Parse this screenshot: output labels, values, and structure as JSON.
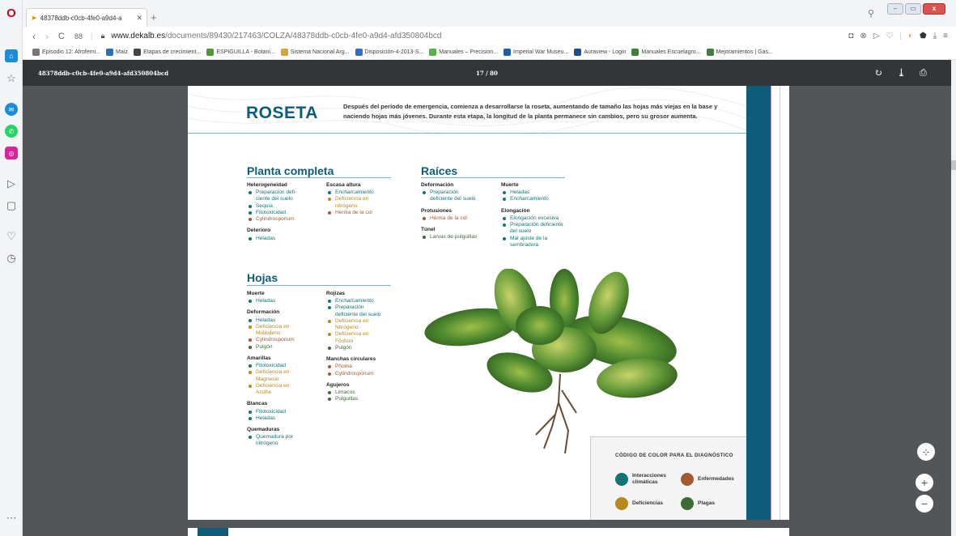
{
  "browser": {
    "tab_title": "48378ddb-c0cb-4fe0-a9d4-a",
    "url_host": "www.dekalb.es",
    "url_path": "/documents/89430/217463/COLZA/48378ddb-c0cb-4fe0-a9d4-afd350804bcd",
    "speed_dial": "88",
    "bookmarks": [
      {
        "label": "Episodio 12: Afrofemi...",
        "color": "#777777"
      },
      {
        "label": "Maíz",
        "color": "#2a6fb8"
      },
      {
        "label": "Etapas de crecimient...",
        "color": "#444444"
      },
      {
        "label": "ESPIGUILLA - Botani...",
        "color": "#4e9a3a"
      },
      {
        "label": "Sistema Nacional Arg...",
        "color": "#d8a534"
      },
      {
        "label": "Disposición-4-2013-S...",
        "color": "#2f6fc2"
      },
      {
        "label": "Manuales – Precision...",
        "color": "#5ab04f"
      },
      {
        "label": "Imperial War Museu...",
        "color": "#1d5fa8"
      },
      {
        "label": "Auraview - Login",
        "color": "#1e4e8f"
      },
      {
        "label": "Manuales Escuelagro...",
        "color": "#3f7f3f"
      },
      {
        "label": "Mejoramientos | Gas...",
        "color": "#3f7f3f"
      }
    ]
  },
  "viewer": {
    "doc_name": "48378ddb-c0cb-4fe0-a9d4-afd350804bcd",
    "page_indicator": "17 / 80"
  },
  "page": {
    "title": "ROSETA",
    "intro": "Después del período de emergencia, comienza a desarrollarse la roseta, aumentando de tamaño las hojas más viejas en la base y naciendo hojas más jóvenes. Durante esta etapa, la longitud de la planta permanece sin cambios, pero su grosor aumenta.",
    "sections": {
      "planta": {
        "title": "Planta completa",
        "col1": [
          {
            "heading": "Heterogeneidad",
            "items": [
              {
                "text": "Preparación defi-",
                "type": "cli"
              },
              {
                "text": "ciente del suelo",
                "type": "cli",
                "cont": true
              },
              {
                "text": "Sequía",
                "type": "cli"
              },
              {
                "text": "Fitotoxicidad",
                "type": "cli"
              },
              {
                "text": "Cylindrosporium",
                "type": "enf"
              }
            ]
          },
          {
            "heading": "Deterioro",
            "items": [
              {
                "text": "Heladas",
                "type": "cli"
              }
            ]
          }
        ],
        "col2": [
          {
            "heading": "Escasa altura",
            "items": [
              {
                "text": "Encharcamiento",
                "type": "cli"
              },
              {
                "text": "Deficiencia en",
                "type": "def"
              },
              {
                "text": "nitrógeno",
                "type": "def",
                "cont": true
              },
              {
                "text": "Hernia de la col",
                "type": "enf"
              }
            ]
          }
        ]
      },
      "raices": {
        "title": "Raíces",
        "col1": [
          {
            "heading": "Deformación",
            "items": [
              {
                "text": "Preparación",
                "type": "cli"
              },
              {
                "text": "deficiente del suelo",
                "type": "cli",
                "cont": true
              }
            ]
          },
          {
            "heading": "Protusiones",
            "items": [
              {
                "text": "Hernia de la col",
                "type": "enf"
              }
            ]
          },
          {
            "heading": "Túnel",
            "items": [
              {
                "text": "Larvas de pulguillas",
                "type": "pla"
              }
            ]
          }
        ],
        "col2": [
          {
            "heading": "Muerte",
            "items": [
              {
                "text": "Heladas",
                "type": "cli"
              },
              {
                "text": "Encharcamiento",
                "type": "cli"
              }
            ]
          },
          {
            "heading": "Elongación",
            "items": [
              {
                "text": "Elongación excesiva",
                "type": "cli"
              },
              {
                "text": "Preparación deficiente",
                "type": "cli"
              },
              {
                "text": "del suelo",
                "type": "cli",
                "cont": true
              },
              {
                "text": "Mal ajuste de la",
                "type": "cli"
              },
              {
                "text": "sembradora",
                "type": "cli",
                "cont": true
              }
            ]
          }
        ]
      },
      "hojas": {
        "title": "Hojas",
        "col1": [
          {
            "heading": "Muerte",
            "items": [
              {
                "text": "Heladas",
                "type": "cli"
              }
            ]
          },
          {
            "heading": "Deformación",
            "items": [
              {
                "text": "Heladas",
                "type": "cli"
              },
              {
                "text": "Deficiencia en",
                "type": "def"
              },
              {
                "text": "Molibdeno",
                "type": "def",
                "cont": true
              },
              {
                "text": "Cylindrosporium",
                "type": "enf"
              },
              {
                "text": "Pulgón",
                "type": "pla"
              }
            ]
          },
          {
            "heading": "Amarillas",
            "items": [
              {
                "text": "Fitotoxicidad",
                "type": "cli"
              },
              {
                "text": "Deficiencia en",
                "type": "def"
              },
              {
                "text": "Magnesio",
                "type": "def",
                "cont": true
              },
              {
                "text": "Deficiencia en",
                "type": "def"
              },
              {
                "text": "Azufre",
                "type": "def",
                "cont": true
              }
            ]
          },
          {
            "heading": "Blancas",
            "items": [
              {
                "text": "Fitotoxicidad",
                "type": "cli"
              },
              {
                "text": "Heladas",
                "type": "cli"
              }
            ]
          },
          {
            "heading": "Quemaduras",
            "items": [
              {
                "text": "Quemadura por",
                "type": "cli"
              },
              {
                "text": "nitrógeno",
                "type": "cli",
                "cont": true
              }
            ]
          }
        ],
        "col2": [
          {
            "heading": "Rojizas",
            "items": [
              {
                "text": "Encharcamiento",
                "type": "cli"
              },
              {
                "text": "Preparación",
                "type": "cli"
              },
              {
                "text": "deficiente del suelo",
                "type": "cli",
                "cont": true
              },
              {
                "text": "Deficiencia en",
                "type": "def"
              },
              {
                "text": "Nitrógeno",
                "type": "def",
                "cont": true
              },
              {
                "text": "Deficiencia en",
                "type": "def"
              },
              {
                "text": "Fósforo",
                "type": "def",
                "cont": true
              },
              {
                "text": "Pulgón",
                "type": "pla"
              }
            ]
          },
          {
            "heading": "Manchas circulares",
            "items": [
              {
                "text": "Phoma",
                "type": "enf"
              },
              {
                "text": "Cylindrosporium",
                "type": "enf"
              }
            ]
          },
          {
            "heading": "Agujeros",
            "items": [
              {
                "text": "Limacos",
                "type": "pla"
              },
              {
                "text": "Pulguillas",
                "type": "pla"
              }
            ]
          }
        ]
      }
    },
    "legend": {
      "title": "CÓDIGO DE COLOR PARA EL DIAGNÓSTICO",
      "climaticas_1": "Interacciones",
      "climaticas_2": "climáticas",
      "enfermedades": "Enfermedades",
      "deficiencias": "Deficiencias",
      "plagas": "Plagas"
    },
    "colors": {
      "climaticas": "#137374",
      "enfermedades": "#a35a33",
      "deficiencias": "#b88a1e",
      "plagas": "#3c6b35",
      "brand": "#0f5c7a"
    }
  }
}
